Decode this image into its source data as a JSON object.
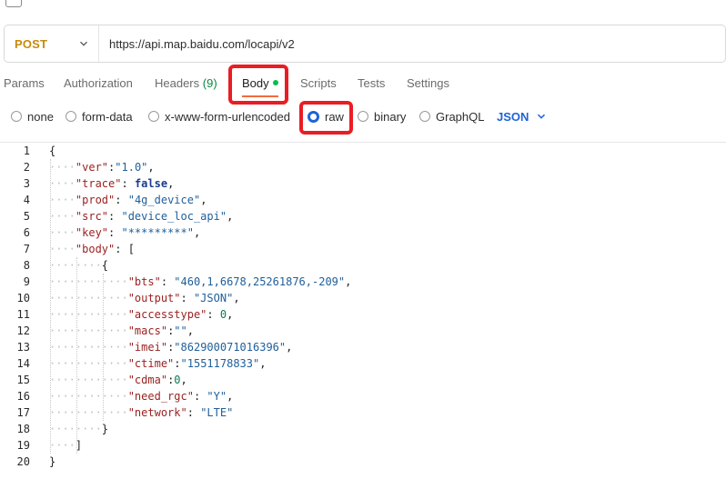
{
  "request": {
    "method": "POST",
    "url": "https://api.map.baidu.com/locapi/v2"
  },
  "tabs": [
    {
      "label": "Params"
    },
    {
      "label": "Authorization"
    },
    {
      "label": "Headers",
      "count": "(9)"
    },
    {
      "label": "Body",
      "active": true
    },
    {
      "label": "Scripts"
    },
    {
      "label": "Tests"
    },
    {
      "label": "Settings"
    }
  ],
  "body_modes": {
    "options": [
      "none",
      "form-data",
      "x-www-form-urlencoded",
      "raw",
      "binary",
      "GraphQL"
    ],
    "selected": "raw",
    "language": "JSON"
  },
  "code_lines": [
    "{",
    "    \"ver\":\"1.0\",",
    "    \"trace\": false,",
    "    \"prod\": \"4g_device\",",
    "    \"src\": \"device_loc_api\",",
    "    \"key\": \"*********\",",
    "    \"body\": [",
    "        {",
    "            \"bts\": \"460,1,6678,25261876,-209\",",
    "            \"output\": \"JSON\",",
    "            \"accesstype\": 0,",
    "            \"macs\":\"\",",
    "            \"imei\":\"862900071016396\",",
    "            \"ctime\":\"1551178833\",",
    "            \"cdma\":0,",
    "            \"need_rgc\": \"Y\",",
    "            \"network\": \"LTE\"",
    "        }",
    "    ]",
    "}"
  ],
  "colors": {
    "method": "#c78b0a",
    "accent": "#1e63d8",
    "highlight_box": "#ea1c24",
    "active_tab_underline": "#f26b3a",
    "body_dot": "#0cbb52",
    "json_key": "#9a1f1f",
    "json_string": "#1f5f99",
    "json_number": "#0a7a50"
  }
}
